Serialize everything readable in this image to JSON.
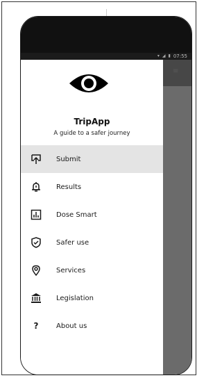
{
  "status_bar": {
    "time": "07:55",
    "icons": [
      "wifi-icon",
      "signal-icon",
      "battery-icon"
    ]
  },
  "drawer": {
    "app_name": "TripApp",
    "tagline": "A guide to a safer journey",
    "logo_icon": "eye-icon",
    "items": [
      {
        "label": "Submit",
        "icon": "upload-icon",
        "active": true
      },
      {
        "label": "Results",
        "icon": "alert-bell-icon",
        "active": false
      },
      {
        "label": "Dose Smart",
        "icon": "bar-chart-icon",
        "active": false
      },
      {
        "label": "Safer use",
        "icon": "shield-check-icon",
        "active": false
      },
      {
        "label": "Services",
        "icon": "location-pin-icon",
        "active": false
      },
      {
        "label": "Legislation",
        "icon": "courthouse-icon",
        "active": false
      },
      {
        "label": "About us",
        "icon": "question-mark-icon",
        "active": false
      }
    ]
  },
  "colors": {
    "active_item_bg": "#e4e4e4",
    "scrim": "#6b6b6b",
    "bezel": "#111111"
  }
}
